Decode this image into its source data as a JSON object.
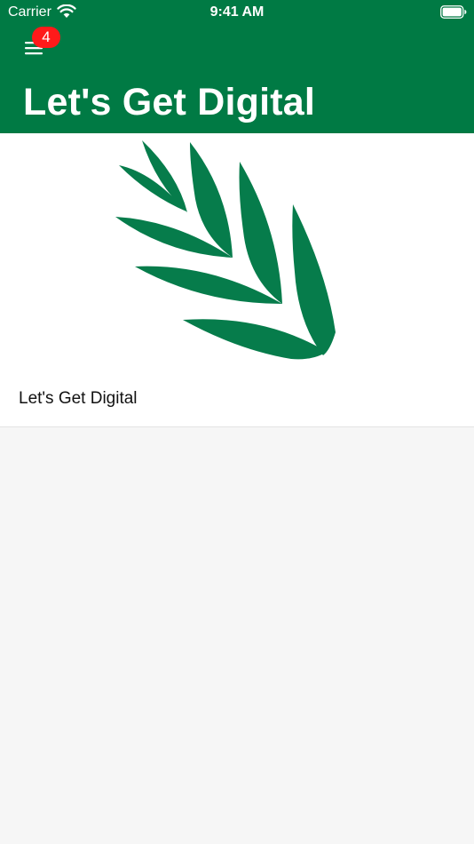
{
  "status_bar": {
    "carrier": "Carrier",
    "time": "9:41 AM",
    "wifi_icon": "wifi-icon",
    "battery_icon": "battery-icon"
  },
  "nav": {
    "menu_icon": "hamburger-menu-icon",
    "badge_count": "4",
    "title": "Let's Get Digital"
  },
  "list": {
    "items": [
      {
        "title": "Let's Get Digital",
        "image": "leaf-logo-icon"
      }
    ]
  },
  "colors": {
    "brand_green": "#007a44",
    "logo_green": "#067c4b",
    "badge_red": "#ff1a1a",
    "background": "#f6f6f6"
  }
}
